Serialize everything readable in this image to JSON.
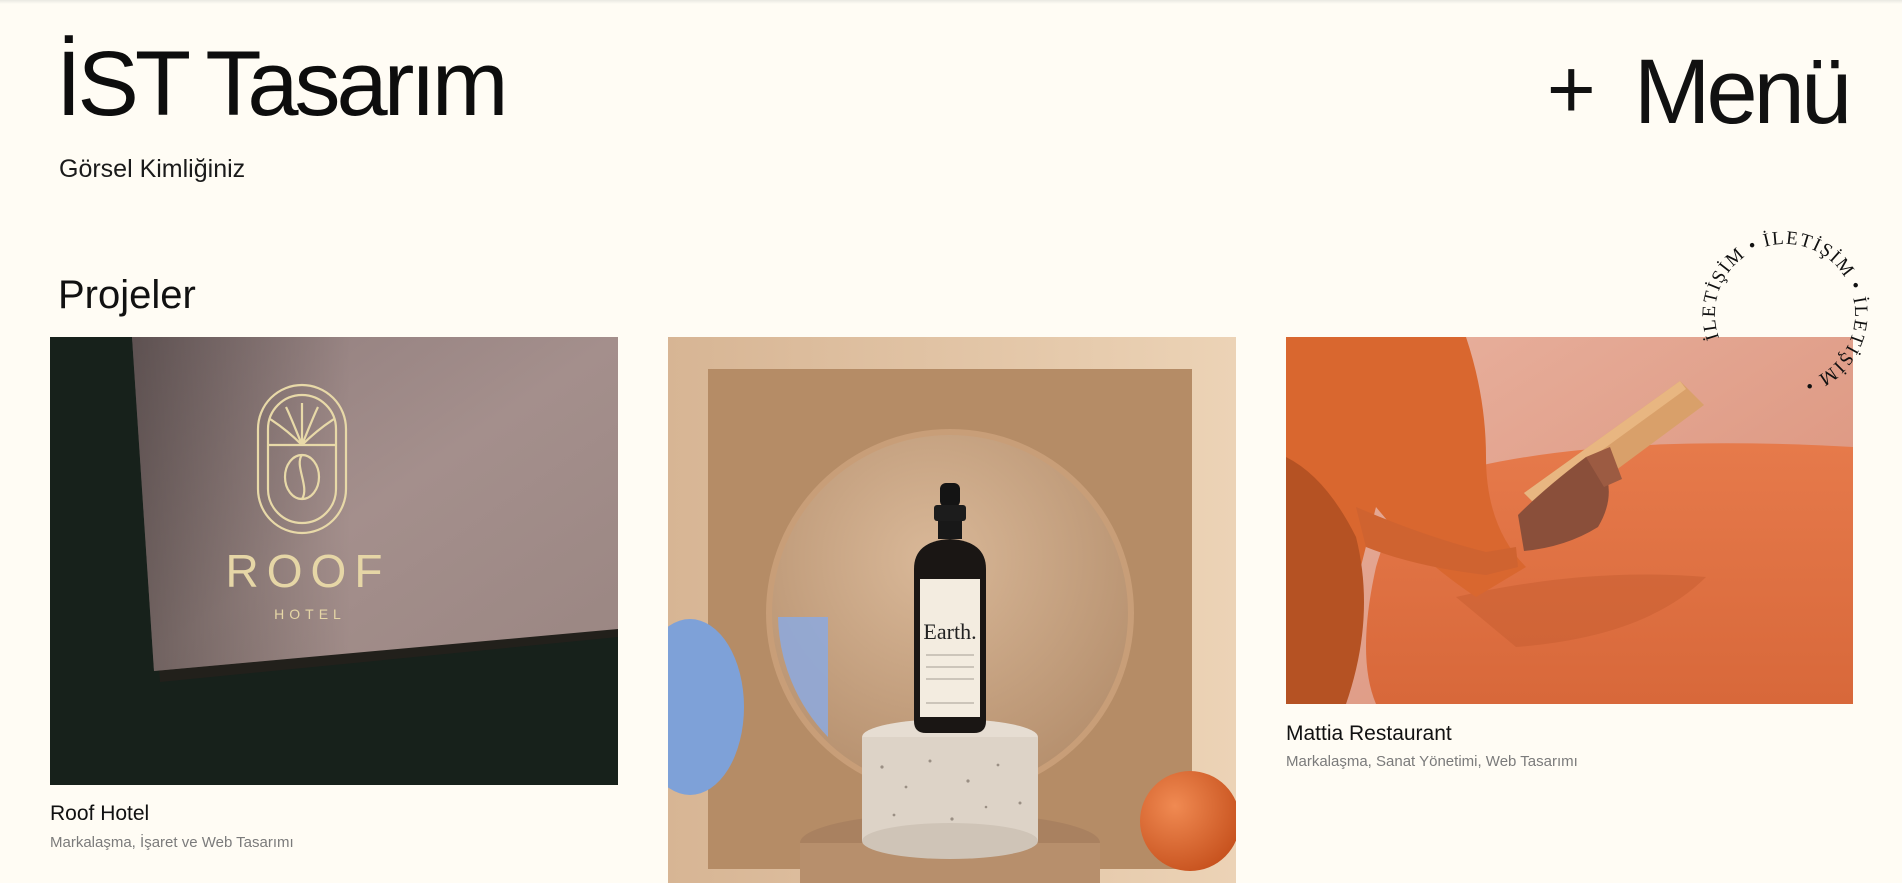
{
  "header": {
    "brand": "İST Tasarım",
    "tagline": "Görsel Kimliğiniz",
    "menu_icon": "plus-icon",
    "menu_plus": "+",
    "menu_label": "Menü"
  },
  "projects_section": {
    "title": "Projeler"
  },
  "contact_badge": {
    "text": "İLETİŞİM • İLETİŞİM • İLETİŞİM •"
  },
  "projects": [
    {
      "title": "Roof Hotel",
      "tags": "Markalaşma, İşaret ve Web Tasarımı",
      "logo_text": "ROOF",
      "logo_subtext": "HOTEL"
    },
    {
      "title": "",
      "tags": "",
      "label_text": "Earth."
    },
    {
      "title": "Mattia Restaurant",
      "tags": "Markalaşma, Sanat Yönetimi, Web Tasarımı"
    }
  ],
  "colors": {
    "background": "#fffcf4",
    "roof_card": "#a08c89",
    "earth_wall": "#b68e68",
    "mattia_orange": "#e0703f"
  }
}
